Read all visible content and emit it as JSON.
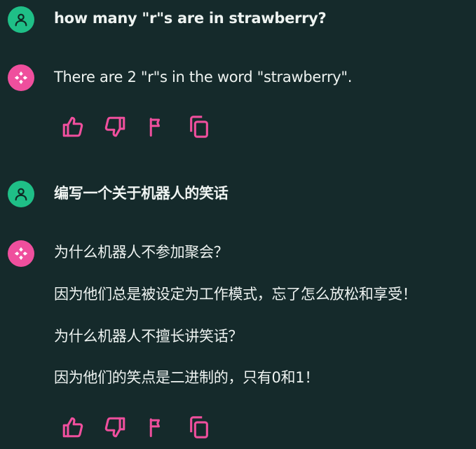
{
  "conversation": {
    "messages": [
      {
        "role": "user",
        "text": "how many \"r\"s are in strawberry?"
      },
      {
        "role": "assistant",
        "paragraphs": [
          "There are 2 \"r\"s in the word \"strawberry\"."
        ]
      },
      {
        "role": "user",
        "text": "编写一个关于机器人的笑话"
      },
      {
        "role": "assistant",
        "paragraphs": [
          "为什么机器人不参加聚会？",
          "因为他们总是被设定为工作模式，忘了怎么放松和享受！",
          "为什么机器人不擅长讲笑话？",
          "因为他们的笑点是二进制的，只有0和1！"
        ]
      }
    ]
  },
  "icons": {
    "user_avatar": "user-icon",
    "assistant_avatar": "assistant-logo-icon",
    "like": "thumbs-up-icon",
    "dislike": "thumbs-down-icon",
    "flag": "flag-icon",
    "copy": "copy-icon"
  },
  "colors": {
    "background": "#152a2b",
    "user_avatar": "#1fbf87",
    "assistant_avatar": "#ef4f9d",
    "action_icons": "#ef4f9d",
    "text": "#eef3f1"
  }
}
